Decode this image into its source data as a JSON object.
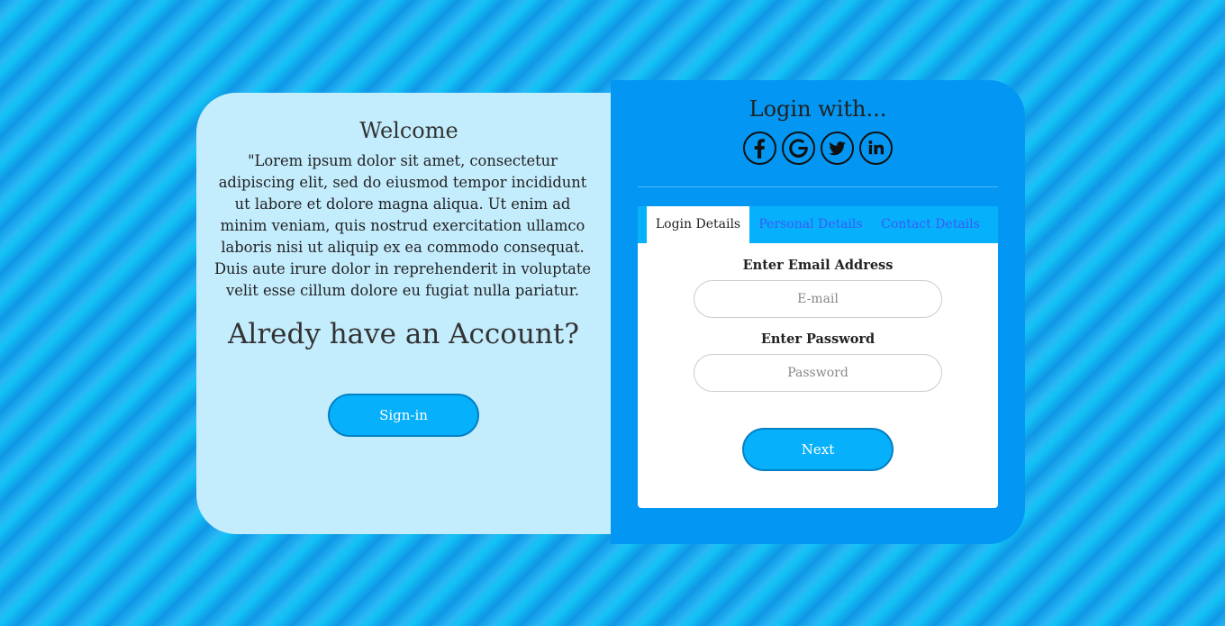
{
  "welcome": {
    "title": "Welcome",
    "text": "\"Lorem ipsum dolor sit amet, consectetur adipiscing elit, sed do eiusmod tempor incididunt ut labore et dolore magna aliqua. Ut enim ad minim veniam, quis nostrud exercitation ullamco laboris nisi ut aliquip ex ea commodo consequat. Duis aute irure dolor in reprehenderit in voluptate velit esse cillum dolore eu fugiat nulla pariatur.",
    "account_question": "Alredy have an Account?",
    "signin_label": "Sign-in"
  },
  "login": {
    "title": "Login with...",
    "socials": [
      {
        "name": "facebook-icon"
      },
      {
        "name": "google-icon"
      },
      {
        "name": "twitter-icon"
      },
      {
        "name": "linkedin-icon"
      }
    ]
  },
  "tabs": [
    {
      "label": "Login Details",
      "active": true
    },
    {
      "label": "Personal Details",
      "active": false
    },
    {
      "label": "Contact Details",
      "active": false
    }
  ],
  "form": {
    "email_label": "Enter Email Address",
    "email_placeholder": "E-mail",
    "email_value": "",
    "password_label": "Enter Password",
    "password_placeholder": "Password",
    "password_value": "",
    "next_label": "Next"
  },
  "colors": {
    "left_panel": "#c3ecfd",
    "right_panel": "#0396f2",
    "button": "#06b0fa",
    "inactive_tab_text": "#3a5bf7"
  }
}
